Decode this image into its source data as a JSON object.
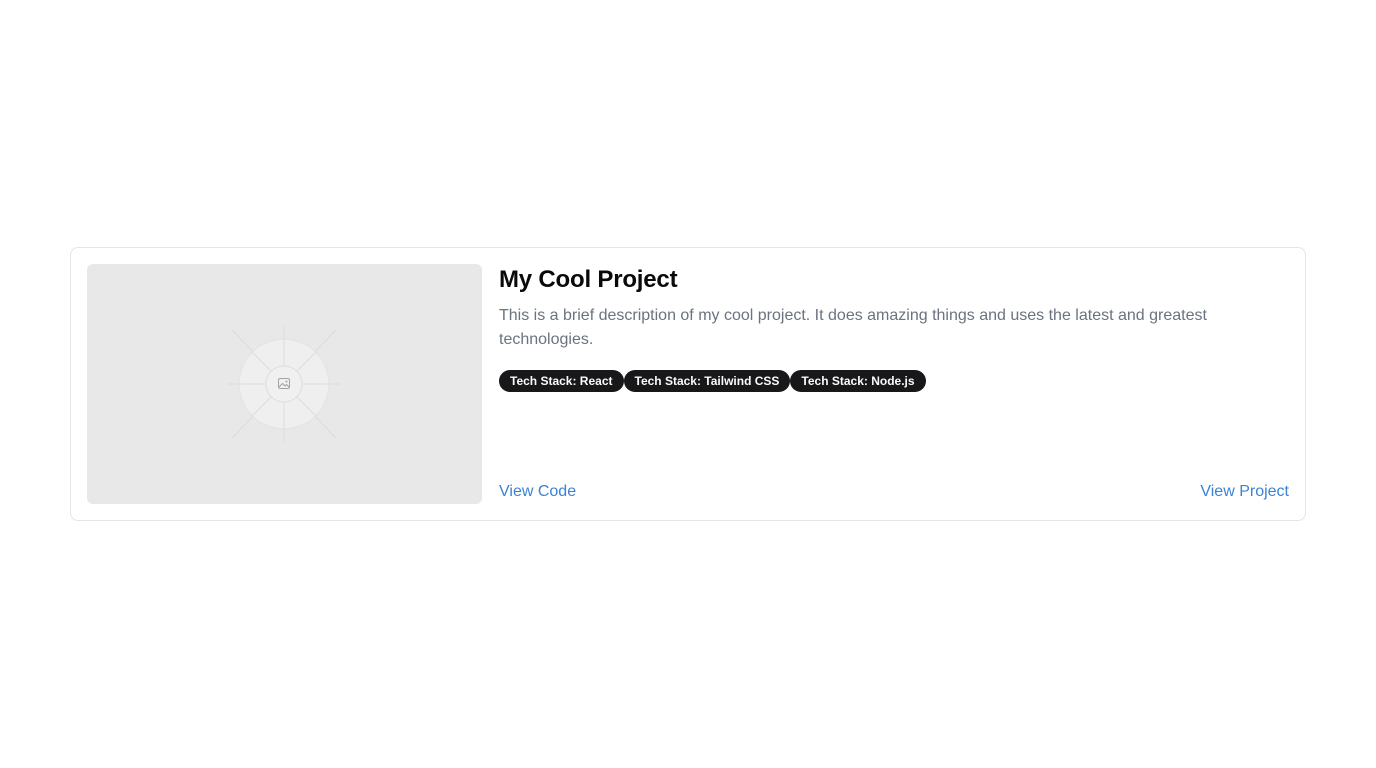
{
  "project": {
    "title": "My Cool Project",
    "description": "This is a brief description of my cool project. It does amazing things and uses the latest and greatest technologies.",
    "image_icon": "image-icon",
    "tags": [
      "Tech Stack: React",
      "Tech Stack: Tailwind CSS",
      "Tech Stack: Node.js"
    ],
    "view_code_label": "View Code",
    "view_project_label": "View Project"
  },
  "colors": {
    "link": "#3b82d6",
    "tag_bg": "#18181b",
    "tag_text": "#fafafa",
    "description": "#6b7280",
    "placeholder_bg": "#e8e8e8"
  }
}
